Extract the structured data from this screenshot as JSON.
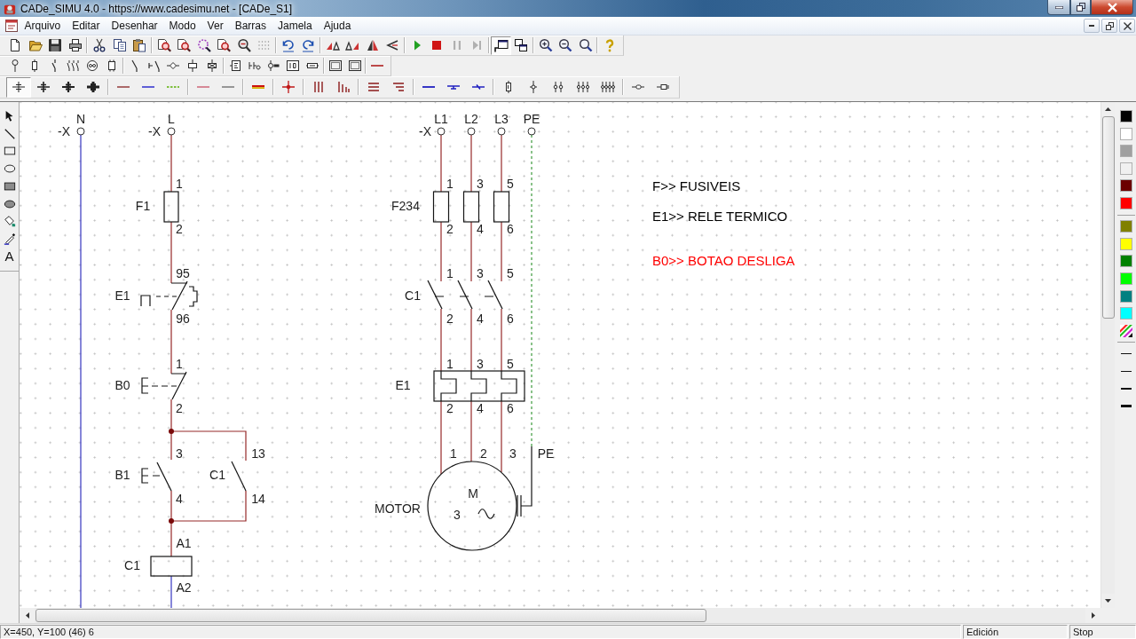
{
  "window": {
    "title": "CADe_SIMU 4.0 - https://www.cadesimu.net - [CADe_S1]"
  },
  "menu": [
    "Arquivo",
    "Editar",
    "Desenhar",
    "Modo",
    "Ver",
    "Barras",
    "Jamela",
    "Ajuda"
  ],
  "toolbars": [
    {
      "buttons": [
        {
          "pressed": false
        },
        {
          "pressed": false
        },
        {
          "pressed": false
        },
        {
          "pressed": false
        },
        {
          "pressed": false
        },
        {
          "pressed": false
        },
        {
          "pressed": false
        },
        {
          "pressed": false
        },
        {
          "pressed": false
        },
        {
          "pressed": false
        },
        {
          "pressed": false
        },
        {
          "pressed": false
        },
        {
          "pressed": false
        },
        {
          "pressed": false
        },
        {
          "pressed": false
        },
        {
          "pressed": false
        },
        {
          "pressed": false
        },
        {
          "pressed": false
        },
        {
          "pressed": false
        },
        {
          "pressed": false
        },
        {
          "pressed": false
        },
        {
          "pressed": false
        },
        {
          "pressed": false
        },
        {
          "pressed": true
        },
        {
          "pressed": false
        },
        {
          "pressed": false
        },
        {
          "pressed": false
        },
        {
          "pressed": false
        },
        {
          "pressed": false
        }
      ]
    },
    {
      "buttons": [
        {
          "pressed": false
        },
        {
          "pressed": false
        },
        {
          "pressed": false
        },
        {
          "pressed": false
        },
        {
          "pressed": false
        },
        {
          "pressed": false
        },
        {
          "pressed": false
        },
        {
          "pressed": false
        },
        {
          "pressed": false
        },
        {
          "pressed": false
        },
        {
          "pressed": false
        },
        {
          "pressed": false
        },
        {
          "pressed": false
        },
        {
          "pressed": false
        },
        {
          "pressed": false
        },
        {
          "pressed": false
        },
        {
          "pressed": false
        },
        {
          "pressed": false
        },
        {
          "pressed": false
        }
      ]
    },
    {
      "buttons": [
        {
          "pressed": true
        },
        {
          "pressed": false
        },
        {
          "pressed": false
        },
        {
          "pressed": false
        },
        {
          "pressed": false
        },
        {
          "pressed": false
        },
        {
          "pressed": false
        },
        {
          "pressed": false
        },
        {
          "pressed": false
        },
        {
          "pressed": false
        },
        {
          "pressed": false
        },
        {
          "pressed": false
        },
        {
          "pressed": false
        },
        {
          "pressed": false
        },
        {
          "pressed": false
        },
        {
          "pressed": false
        },
        {
          "pressed": false
        },
        {
          "pressed": false
        },
        {
          "pressed": false
        },
        {
          "pressed": false
        },
        {
          "pressed": false
        },
        {
          "pressed": false
        },
        {
          "pressed": false
        },
        {
          "pressed": false
        },
        {
          "pressed": false
        }
      ]
    }
  ],
  "tool_palette": {
    "text_tool": "A"
  },
  "schematic": {
    "control_circuit": {
      "terminals": [
        {
          "prefix": "-X",
          "label": "N"
        },
        {
          "prefix": "-X",
          "label": "L"
        }
      ],
      "devices": [
        {
          "kind": "fuse",
          "tag": "F1",
          "pins": [
            "1",
            "2"
          ]
        },
        {
          "kind": "thermal_contact",
          "tag": "E1",
          "pins": [
            "95",
            "96"
          ]
        },
        {
          "kind": "stop_button",
          "tag": "B0",
          "pins": [
            "1",
            "2"
          ]
        },
        {
          "kind": "start_button",
          "tag": "B1",
          "pins": [
            "3",
            "4"
          ]
        },
        {
          "kind": "no_contact",
          "tag": "C1",
          "pins": [
            "13",
            "14"
          ]
        },
        {
          "kind": "coil",
          "tag": "C1",
          "pins": [
            "A1",
            "A2"
          ]
        }
      ]
    },
    "power_circuit": {
      "terminal_prefix": "-X",
      "terminals": [
        "L1",
        "L2",
        "L3",
        "PE"
      ],
      "devices": [
        {
          "kind": "fuses",
          "tag": "F234",
          "pins": [
            "1",
            "3",
            "5",
            "2",
            "4",
            "6"
          ]
        },
        {
          "kind": "main_contacts",
          "tag": "C1",
          "pins": [
            "1",
            "3",
            "5",
            "2",
            "4",
            "6"
          ]
        },
        {
          "kind": "overload_relay",
          "tag": "E1",
          "pins": [
            "1",
            "3",
            "5",
            "2",
            "4",
            "6"
          ]
        },
        {
          "kind": "motor",
          "tag": "MOTOR",
          "pins": [
            "1",
            "2",
            "3",
            "PE"
          ],
          "symbol": "M",
          "phases": "3"
        }
      ]
    }
  },
  "notes": [
    {
      "text": "F>> FUSIVEIS",
      "color": "#000000"
    },
    {
      "text": "E1>> RELE TERMICO",
      "color": "#000000"
    },
    {
      "text": "B0>> BOTAO DESLIGA",
      "color": "#ff0000"
    }
  ],
  "color_palette": [
    {
      "color": "#000000"
    },
    {
      "color": "#ffffff"
    },
    {
      "color": "#a0a0a0"
    },
    {
      "color": "#f0f0f0"
    },
    {
      "color": "#6b0000"
    },
    {
      "color": "#ff0000"
    },
    {
      "color": "#808000"
    },
    {
      "color": "#ffff00"
    },
    {
      "color": "#008000"
    },
    {
      "color": "#00ff00"
    },
    {
      "color": "#008080"
    },
    {
      "color": "#00ffff"
    }
  ],
  "status_bar": {
    "position": "X=450, Y=100 (46) 6",
    "mode": "Edición",
    "state": "Stop"
  }
}
